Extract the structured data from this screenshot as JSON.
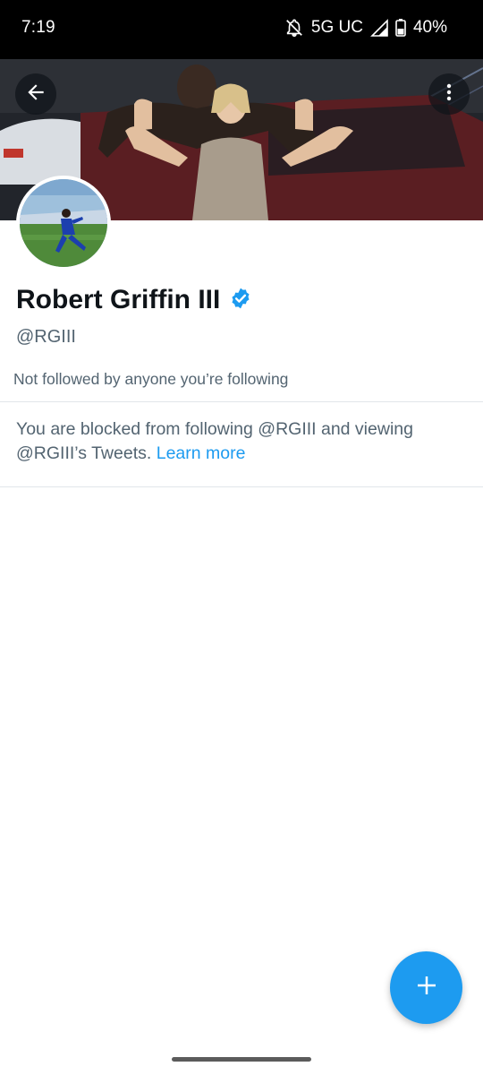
{
  "status_bar": {
    "time": "7:19",
    "network": "5G UC",
    "battery": "40%",
    "icons": [
      "bell-off-icon",
      "signal-icon",
      "battery-icon"
    ]
  },
  "header": {
    "back_icon": "arrow-left-icon",
    "more_icon": "more-vertical-icon"
  },
  "profile": {
    "name": "Robert Griffin III",
    "verified_icon": "verified-badge-icon",
    "handle": "@RGIII",
    "followed_by": "Not followed by anyone you’re following"
  },
  "blocked_notice": {
    "text": "You are blocked from following @RGIII and viewing @RGIII’s Tweets.",
    "link": "Learn more"
  },
  "fab": {
    "icon": "plus-icon"
  },
  "colors": {
    "accent": "#1d9bf0",
    "text_primary": "#0f1419",
    "text_secondary": "#536471"
  }
}
